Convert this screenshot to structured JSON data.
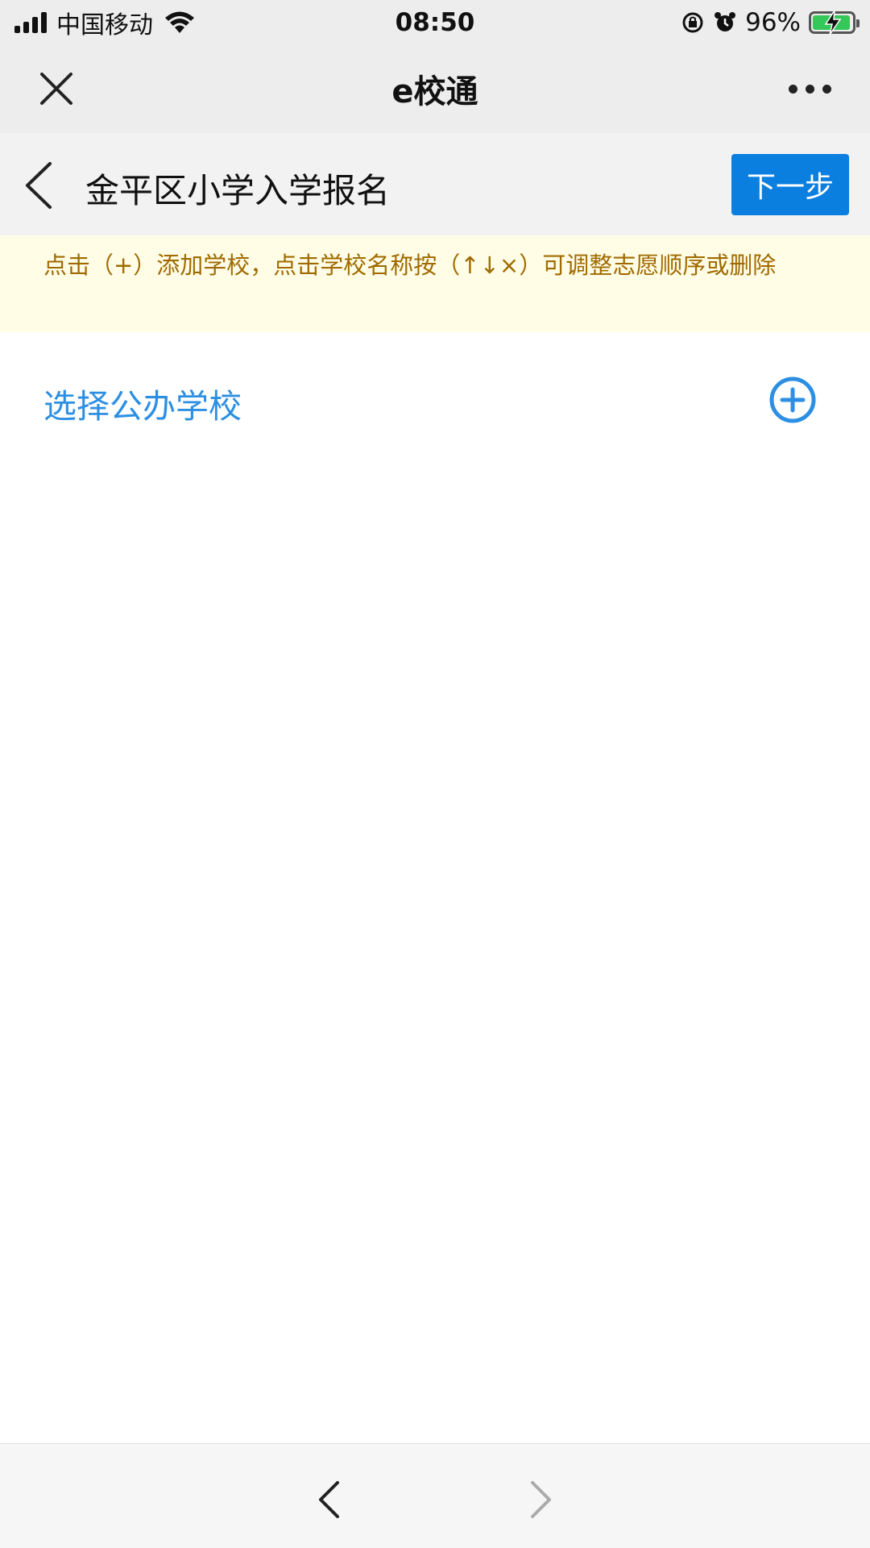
{
  "status_bar": {
    "carrier": "中国移动",
    "time": "08:50",
    "battery_percent": "96%",
    "battery_level": 0.96,
    "icons": [
      "signal-icon",
      "wifi-icon",
      "rotation-lock-icon",
      "alarm-icon",
      "battery-icon"
    ]
  },
  "wechat_header": {
    "title": "e校通",
    "icons": [
      "close-icon",
      "more-icon"
    ]
  },
  "page_header": {
    "title": "金平区小学入学报名",
    "next_label": "下一步",
    "icons": [
      "back-icon"
    ]
  },
  "notice": {
    "text": "点击（+）添加学校，点击学校名称按（↑↓×）可调整志愿顺序或删除"
  },
  "school_select": {
    "label": "选择公办学校",
    "icons": [
      "add-circle-icon"
    ]
  },
  "bottom_nav": {
    "icons": [
      "nav-back-icon",
      "nav-forward-icon"
    ]
  },
  "colors": {
    "accent": "#0a7fe0",
    "link_blue": "#2c8fe3",
    "notice_bg": "#fffde6",
    "notice_text": "#a06a00",
    "header_bg": "#ededed",
    "battery_green": "#34c759"
  }
}
